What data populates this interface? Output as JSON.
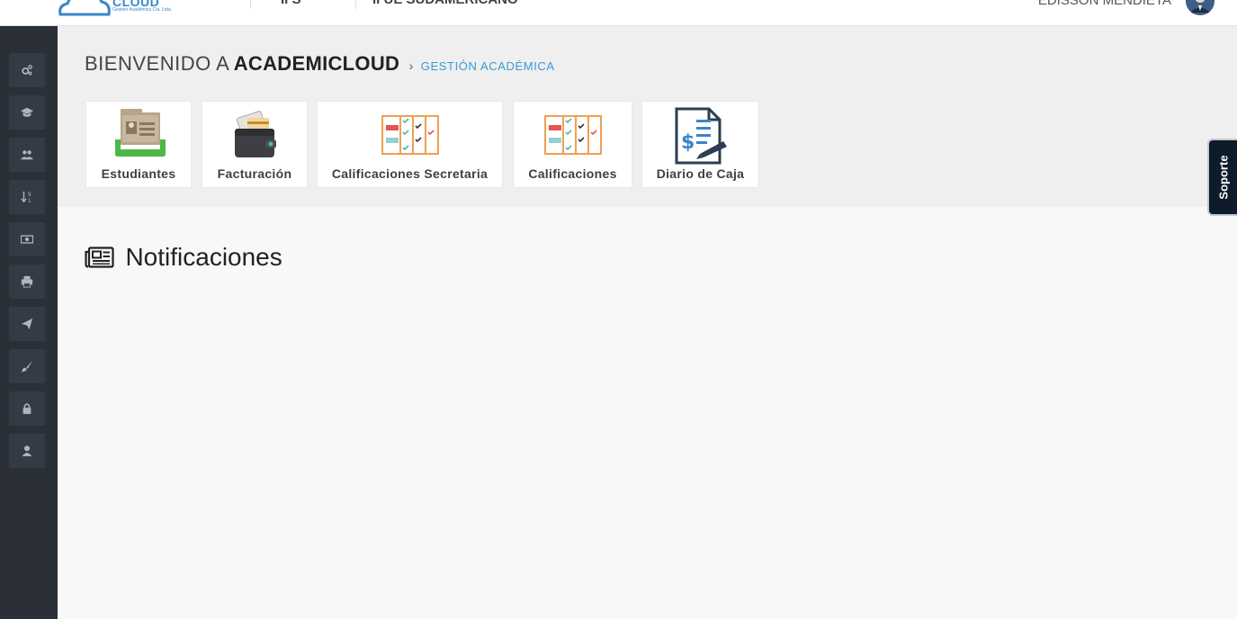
{
  "header": {
    "logo_text": "CLOUD",
    "logo_subtitle": "Gestión Académica Cía. Ltda.",
    "top_item_1": "II  S",
    "top_item_2": "II  UE SUDAMERICANO",
    "user_name": "EDISSON MENDIETA"
  },
  "sidebar": {
    "items": [
      {
        "icon": "cogs-icon"
      },
      {
        "icon": "graduation-cap-icon"
      },
      {
        "icon": "users-icon"
      },
      {
        "icon": "sort-numeric-icon"
      },
      {
        "icon": "money-icon"
      },
      {
        "icon": "print-icon"
      },
      {
        "icon": "send-icon"
      },
      {
        "icon": "paint-brush-icon"
      },
      {
        "icon": "lock-icon"
      },
      {
        "icon": "user-icon"
      }
    ]
  },
  "welcome": {
    "prefix": "BIENVENIDO A",
    "brand": "ACADEMICLOUD",
    "chevron": "›",
    "section": "GESTIÓN ACADÉMICA"
  },
  "tiles": [
    {
      "label": "Estudiantes",
      "icon": "student-records-icon"
    },
    {
      "label": "Facturación",
      "icon": "wallet-icon"
    },
    {
      "label": "Calificaciones Secretaria",
      "icon": "grades-checklist-icon"
    },
    {
      "label": "Calificaciones",
      "icon": "grades-checklist-icon"
    },
    {
      "label": "Diario de Caja",
      "icon": "cash-journal-icon"
    }
  ],
  "notifications": {
    "title": "Notificaciones",
    "icon": "newspaper-icon"
  },
  "support": {
    "label": "Soporte"
  },
  "colors": {
    "sidebar": "#2a2f38",
    "accent_blue": "#3a9ad9",
    "support_tab": "#0d1b2a",
    "grades_red": "#e8544f",
    "grades_teal": "#96d0d0",
    "grades_orange": "#f0a050",
    "student_green": "#4db848"
  }
}
